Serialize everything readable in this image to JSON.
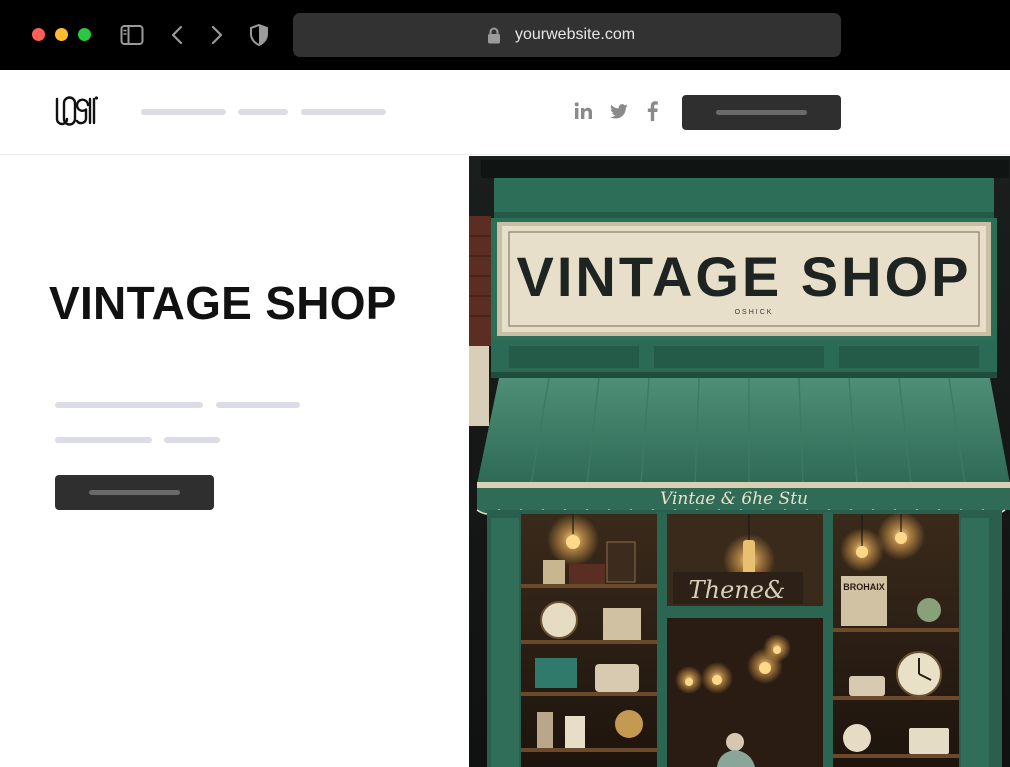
{
  "browser": {
    "url": "yourwebsite.com",
    "traffic_lights": [
      "#ff5f57",
      "#febc2e",
      "#28c840"
    ]
  },
  "header": {
    "logo_text": "LOGO",
    "social_icons": [
      "linkedin-icon",
      "twitter-icon",
      "facebook-icon"
    ]
  },
  "hero": {
    "title": "VINTAGE SHOP",
    "sign_text": "VINTAGE SHOP",
    "sign_subtext": "OSHICK",
    "awning_text": "Vintae & 6he Stu",
    "window_sign": "Thene&",
    "placard": "BROHAIX",
    "accent_color": "#2f6b57"
  }
}
